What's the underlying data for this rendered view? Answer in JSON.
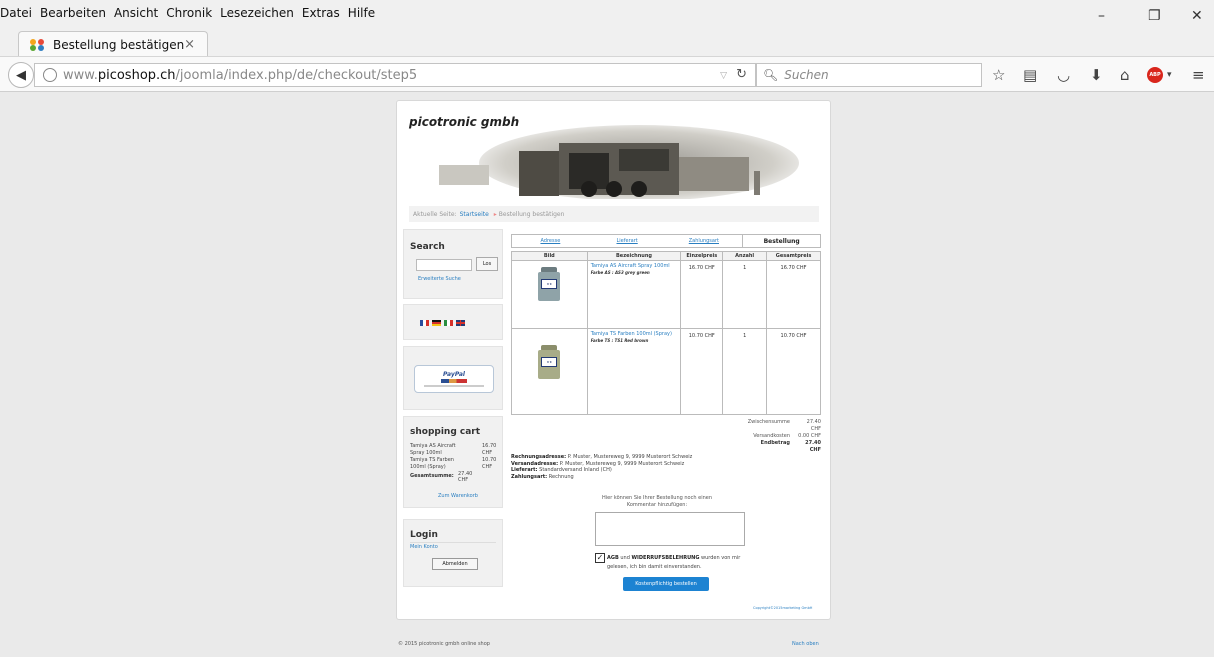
{
  "menubar": [
    "Datei",
    "Bearbeiten",
    "Ansicht",
    "Chronik",
    "Lesezeichen",
    "Extras",
    "Hilfe"
  ],
  "window": {
    "minimize": "–",
    "maximize": "❐",
    "close": "✕"
  },
  "tab": {
    "title": "Bestellung bestätigen",
    "close": "×",
    "new_tab": "+"
  },
  "nav": {
    "url_prefix": "www.",
    "url_host": "picoshop.ch",
    "url_path": "/joomla/index.php/de/checkout/step5",
    "search_placeholder": "Suchen",
    "abp_label": "ABP"
  },
  "site": {
    "brand": "picotronic gmbh",
    "breadcrumb": {
      "label": "Aktuelle Seite:",
      "home": "Startseite",
      "current": "Bestellung bestätigen"
    }
  },
  "sidebar": {
    "search": {
      "title": "Search",
      "button": "Los",
      "advanced": "Erweiterte Suche"
    },
    "paypal": {
      "label": "PayPal"
    },
    "cart": {
      "title": "shopping cart",
      "items": [
        {
          "name": "Tamiya AS Aircraft Spray 100ml",
          "price": "16.70 CHF"
        },
        {
          "name": "Tamiya TS Farben 100ml (Spray)",
          "price": "10.70 CHF"
        }
      ],
      "total_label": "Gesamtsumme:",
      "total_value": "27.40 CHF",
      "link": "Zum Warenkorb"
    },
    "login": {
      "title": "Login",
      "account": "Mein Konto",
      "logout": "Abmelden"
    }
  },
  "checkout": {
    "steps": [
      "Adresse",
      "Lieferart",
      "Zahlungsart",
      "Bestellung"
    ],
    "columns": [
      "Bild",
      "Bezeichnung",
      "Einzelpreis",
      "Anzahl",
      "Gesamtpreis"
    ],
    "rows": [
      {
        "name": "Tamiya AS Aircraft Spray 100ml",
        "variant": "Farbe AS : AS3 grey green",
        "unit": "16.70 CHF",
        "qty": "1",
        "total": "16.70 CHF",
        "can_color": "#8fa3a8"
      },
      {
        "name": "Tamiya TS Farben 100ml (Spray)",
        "variant": "Farbe TS : TS1 Red brown",
        "unit": "10.70 CHF",
        "qty": "1",
        "total": "10.70 CHF",
        "can_color": "#a8ac88"
      }
    ],
    "totals": [
      {
        "label": "Zwischensumme",
        "value": "27.40 CHF"
      },
      {
        "label": "Versandkosten",
        "value": "0.00 CHF"
      },
      {
        "label": "Endbetrag",
        "value": "27.40 CHF"
      }
    ],
    "billing_label": "Rechnungsadresse:",
    "billing": "P. Muster, Mustereweg 9, 9999 Musterort Schweiz",
    "shipping_label": "Versandadresse:",
    "shipping": "P. Muster, Mustereweg 9, 9999 Musterort Schweiz",
    "delivery_label": "Lieferart:",
    "delivery": "Standardversand Inland (CH)",
    "payment_label": "Zahlungsart:",
    "payment": "Rechnung",
    "comment_label": "Hier können Sie Ihrer Bestellung noch einen Kommentar hinzufügen:",
    "agree_text_1": "AGB",
    "agree_text_2": "und",
    "agree_text_3": "WIDERRUFSBELEHRUNG",
    "agree_text_4": "wurden von mir gelesen, ich bin damit einverstanden.",
    "order_button": "Kostenpflichtig bestellen",
    "copyright": "Copyright©2015marketing GmbH"
  },
  "footer": {
    "left": "© 2015 picotronic gmbh online shop",
    "right": "Nach oben"
  },
  "colors": {
    "link": "#2a7fc1",
    "button": "#1d83d2",
    "abp": "#d9261c"
  }
}
